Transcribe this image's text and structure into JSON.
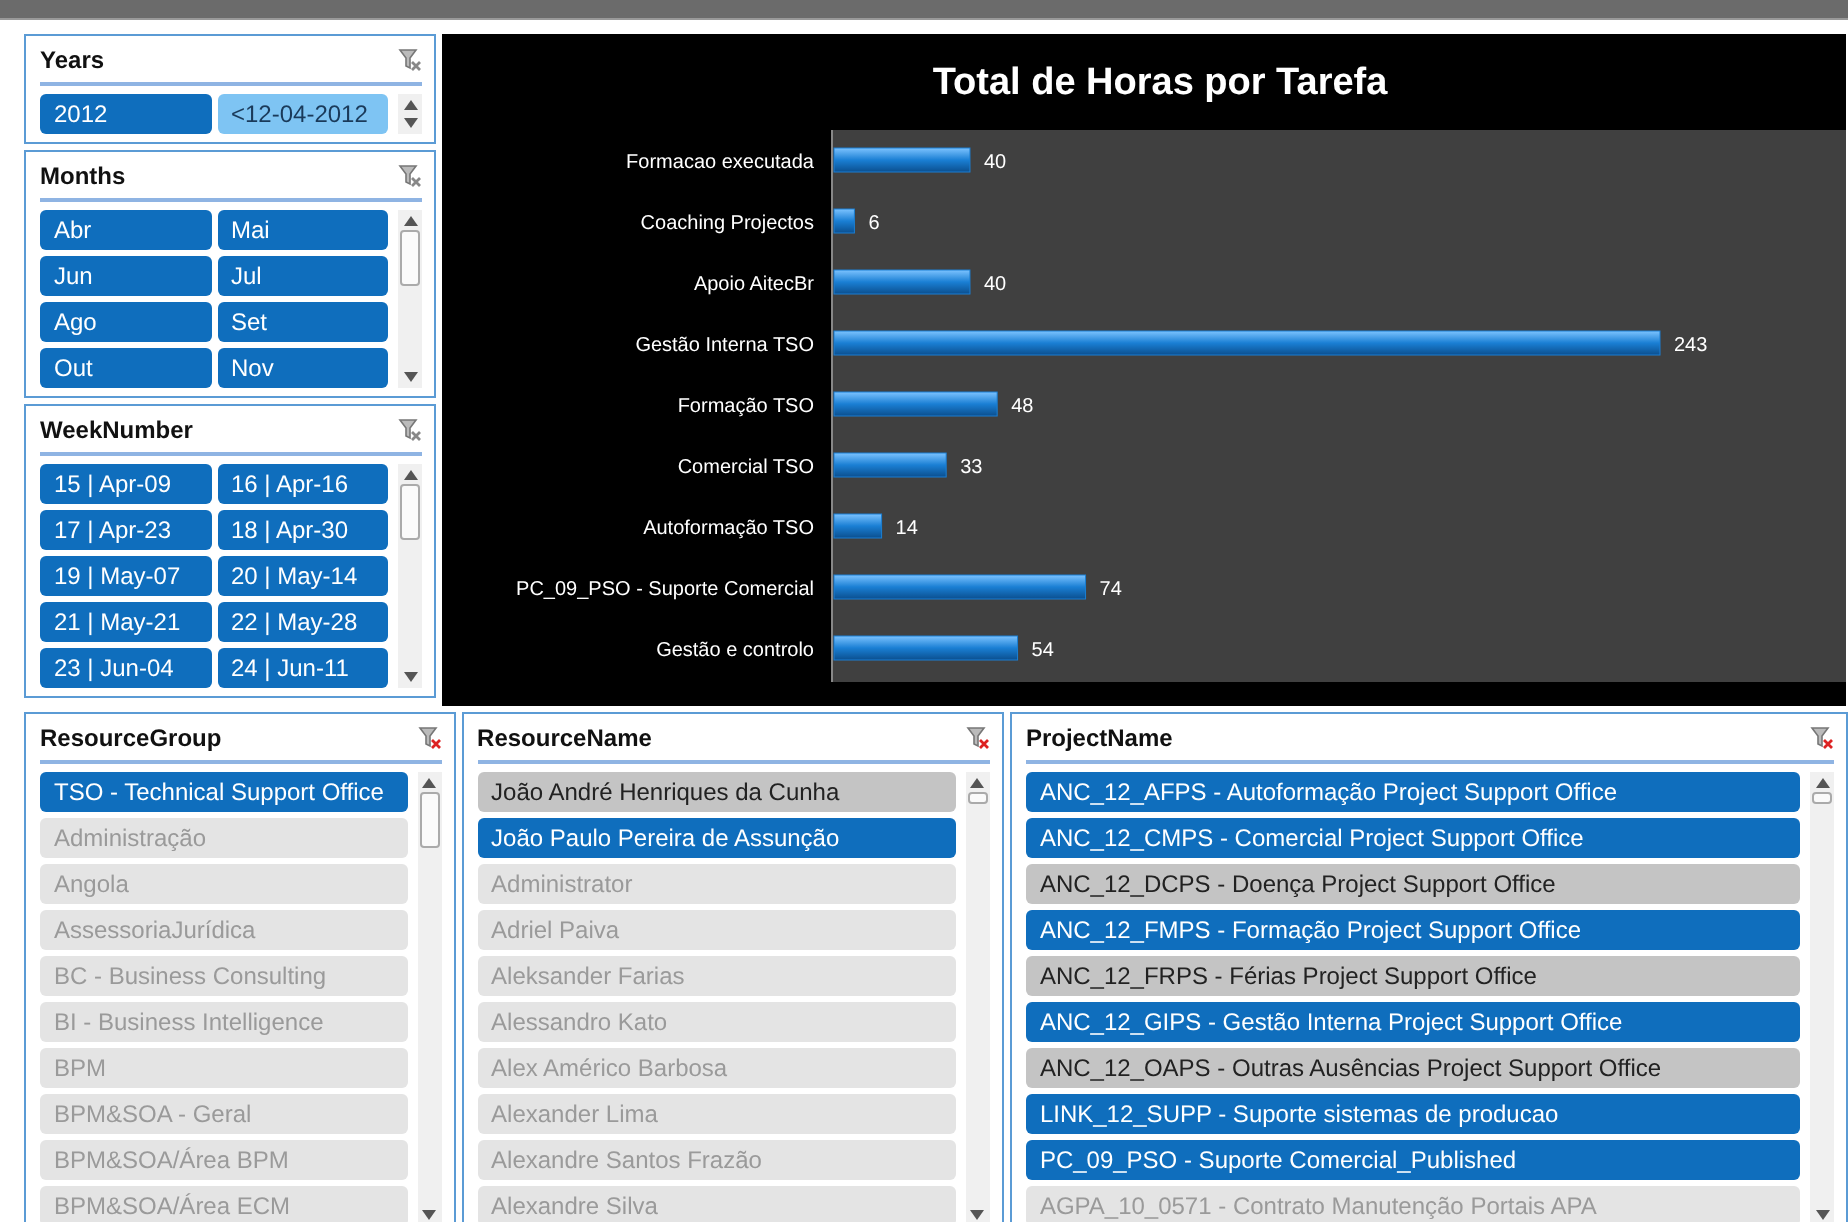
{
  "slicers_left": [
    {
      "title": "Years",
      "items": [
        {
          "label": "2012",
          "selected": true
        },
        {
          "label": "<12-04-2012",
          "selected": false,
          "hovered": true
        }
      ]
    },
    {
      "title": "Months",
      "items": [
        {
          "label": "Abr",
          "selected": true
        },
        {
          "label": "Mai",
          "selected": true
        },
        {
          "label": "Jun",
          "selected": true
        },
        {
          "label": "Jul",
          "selected": true
        },
        {
          "label": "Ago",
          "selected": true
        },
        {
          "label": "Set",
          "selected": true
        },
        {
          "label": "Out",
          "selected": true
        },
        {
          "label": "Nov",
          "selected": true
        }
      ]
    },
    {
      "title": "WeekNumber",
      "items": [
        {
          "label": "15 | Apr-09",
          "selected": true
        },
        {
          "label": "16 | Apr-16",
          "selected": true
        },
        {
          "label": "17 | Apr-23",
          "selected": true
        },
        {
          "label": "18 | Apr-30",
          "selected": true
        },
        {
          "label": "19 | May-07",
          "selected": true
        },
        {
          "label": "20 | May-14",
          "selected": true
        },
        {
          "label": "21 | May-21",
          "selected": true
        },
        {
          "label": "22 | May-28",
          "selected": true
        },
        {
          "label": "23 | Jun-04",
          "selected": true
        },
        {
          "label": "24 | Jun-11",
          "selected": true
        }
      ]
    }
  ],
  "chart": {
    "chart_data": {
      "type": "bar",
      "orientation": "horizontal",
      "title": "Total de Horas por Tarefa",
      "data_labels": true,
      "categories": [
        "Formacao executada",
        "Coaching Projectos",
        "Apoio AitecBr",
        "Gestão Interna TSO",
        "Formação TSO",
        "Comercial TSO",
        "Autoformação TSO",
        "PC_09_PSO - Suporte Comercial",
        "Gestão e controlo"
      ],
      "series": [
        {
          "color": "#1a7fd4",
          "values": [
            40,
            6,
            40,
            243,
            48,
            33,
            14,
            74,
            54
          ]
        }
      ]
    }
  },
  "slicers_bottom": [
    {
      "title": "ResourceGroup",
      "filtered": true,
      "items": [
        {
          "label": "TSO - Technical Support Office",
          "selected": true
        },
        {
          "label": "Administração",
          "selected": false,
          "has_data": false
        },
        {
          "label": "Angola",
          "selected": false,
          "has_data": false
        },
        {
          "label": "AssessoriaJurídica",
          "selected": false,
          "has_data": false
        },
        {
          "label": "BC - Business Consulting",
          "selected": false,
          "has_data": false
        },
        {
          "label": "BI - Business Intelligence",
          "selected": false,
          "has_data": false
        },
        {
          "label": "BPM",
          "selected": false,
          "has_data": false
        },
        {
          "label": "BPM&SOA - Geral",
          "selected": false,
          "has_data": false
        },
        {
          "label": "BPM&SOA/Área BPM",
          "selected": false,
          "has_data": false
        },
        {
          "label": "BPM&SOA/Área ECM",
          "selected": false,
          "has_data": false
        }
      ]
    },
    {
      "title": "ResourceName",
      "filtered": true,
      "items": [
        {
          "label": "João André Henriques da Cunha",
          "selected": false,
          "has_data": true
        },
        {
          "label": "João Paulo Pereira de Assunção",
          "selected": true
        },
        {
          "label": "Administrator",
          "selected": false,
          "has_data": false
        },
        {
          "label": "Adriel Paiva",
          "selected": false,
          "has_data": false
        },
        {
          "label": "Aleksander Farias",
          "selected": false,
          "has_data": false
        },
        {
          "label": "Alessandro Kato",
          "selected": false,
          "has_data": false
        },
        {
          "label": "Alex Américo Barbosa",
          "selected": false,
          "has_data": false
        },
        {
          "label": "Alexander Lima",
          "selected": false,
          "has_data": false
        },
        {
          "label": "Alexandre Santos Frazão",
          "selected": false,
          "has_data": false
        },
        {
          "label": "Alexandre Silva",
          "selected": false,
          "has_data": false
        }
      ]
    },
    {
      "title": "ProjectName",
      "filtered": true,
      "items": [
        {
          "label": "ANC_12_AFPS - Autoformação Project Support Office",
          "selected": true
        },
        {
          "label": "ANC_12_CMPS - Comercial Project Support Office",
          "selected": true
        },
        {
          "label": "ANC_12_DCPS - Doença Project Support Office",
          "selected": false,
          "has_data": true
        },
        {
          "label": "ANC_12_FMPS - Formação Project Support Office",
          "selected": true
        },
        {
          "label": "ANC_12_FRPS - Férias Project Support Office",
          "selected": false,
          "has_data": true
        },
        {
          "label": "ANC_12_GIPS - Gestão Interna Project Support Office",
          "selected": true
        },
        {
          "label": "ANC_12_OAPS - Outras Ausências Project Support Office",
          "selected": false,
          "has_data": true
        },
        {
          "label": "LINK_12_SUPP - Suporte sistemas de producao",
          "selected": true
        },
        {
          "label": "PC_09_PSO - Suporte Comercial_Published",
          "selected": true
        },
        {
          "label": "AGPA_10_0571 - Contrato Manutenção Portais APA",
          "selected": false,
          "has_data": false
        }
      ]
    }
  ]
}
